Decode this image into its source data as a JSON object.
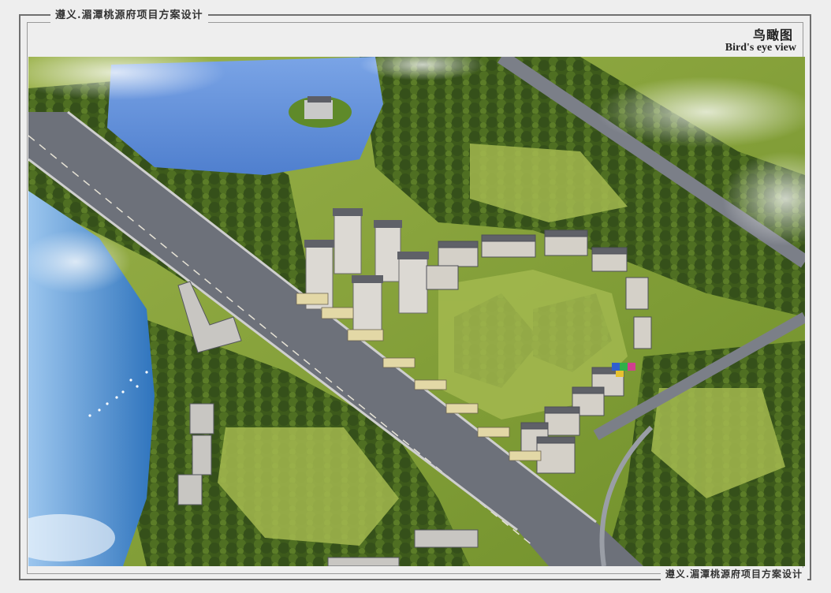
{
  "header": {
    "project_title": "遵义.湄潭桃源府项目方案设计",
    "view_title_zh": "鸟瞰图",
    "view_title_en": "Bird's eye view"
  },
  "footer": {
    "project_title": "遵义.湄潭桃源府项目方案设计"
  },
  "render": {
    "colors": {
      "grass": "#8aa53c",
      "forest": "#3e5a1c",
      "lake": "#5f8fd6",
      "river": "#3f86c9",
      "road": "#6a6f78",
      "tower": "#d9d6d0",
      "roof": "#5f6168"
    }
  }
}
